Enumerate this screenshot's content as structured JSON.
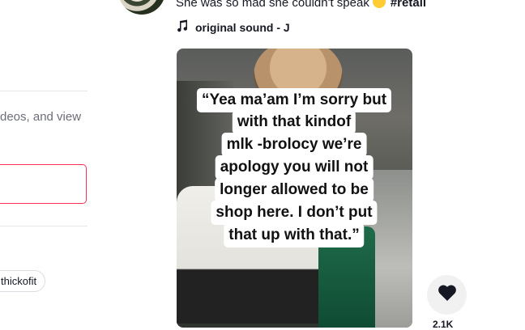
{
  "sidebar": {
    "login_prompt_text": "deos, and view",
    "suggested_tag": "thickofit"
  },
  "post": {
    "caption": "She was so mad she couldn't speak",
    "hashtag": "#retail",
    "sound": "original sound - J",
    "video_overlay_lines": [
      "“Yea ma’am I’m sorry but",
      "with that kindof",
      "mlk -brolocy we’re",
      "apology you will not",
      "longer allowed to be",
      "shop here. I don’t put",
      "that up with that.”"
    ],
    "like_count": "2.1K"
  }
}
